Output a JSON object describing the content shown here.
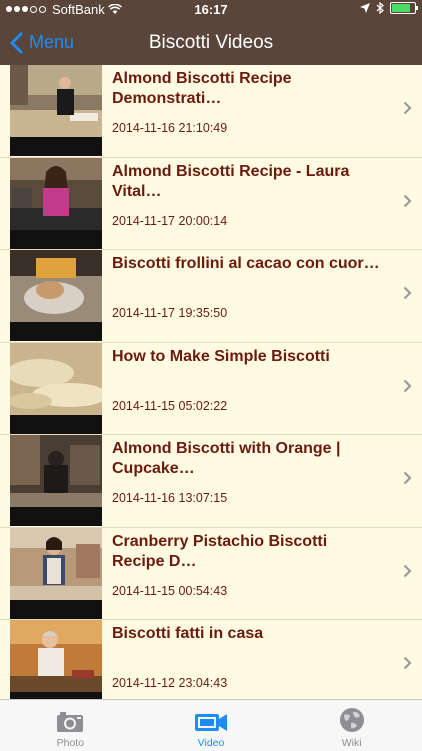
{
  "status": {
    "carrier": "SoftBank",
    "time": "16:17"
  },
  "nav": {
    "back_label": "Menu",
    "title": "Biscotti Videos"
  },
  "videos": [
    {
      "title": "Almond Biscotti Recipe Demonstrati…",
      "date": "2014-11-16 21:10:49",
      "scene": "kitchen-woman-black"
    },
    {
      "title": "Almond Biscotti Recipe - Laura Vital…",
      "date": "2014-11-17 20:00:14",
      "scene": "kitchen-woman-pink"
    },
    {
      "title": "Biscotti frollini al cacao con cuor…",
      "date": "2014-11-17 19:35:50",
      "scene": "dough-hands"
    },
    {
      "title": "How to Make Simple Biscotti",
      "date": "2014-11-15 05:02:22",
      "scene": "biscotti-closeup"
    },
    {
      "title": "Almond Biscotti with Orange | Cupcake…",
      "date": "2014-11-16 13:07:15",
      "scene": "kitchen-dark"
    },
    {
      "title": "Cranberry Pistachio Biscotti Recipe D…",
      "date": "2014-11-15 00:54:43",
      "scene": "kitchen-apron"
    },
    {
      "title": "Biscotti fatti in casa",
      "date": "2014-11-12 23:04:43",
      "scene": "kitchen-elder"
    }
  ],
  "tabs": [
    {
      "label": "Photo",
      "icon": "camera-icon",
      "active": false
    },
    {
      "label": "Video",
      "icon": "video-camera-icon",
      "active": true
    },
    {
      "label": "Wiki",
      "icon": "globe-icon",
      "active": false
    }
  ],
  "colors": {
    "bar": "#5a453a",
    "accent": "#1e8cf7",
    "title_text": "#6b1a10",
    "row_bg": "#fffbe3"
  }
}
